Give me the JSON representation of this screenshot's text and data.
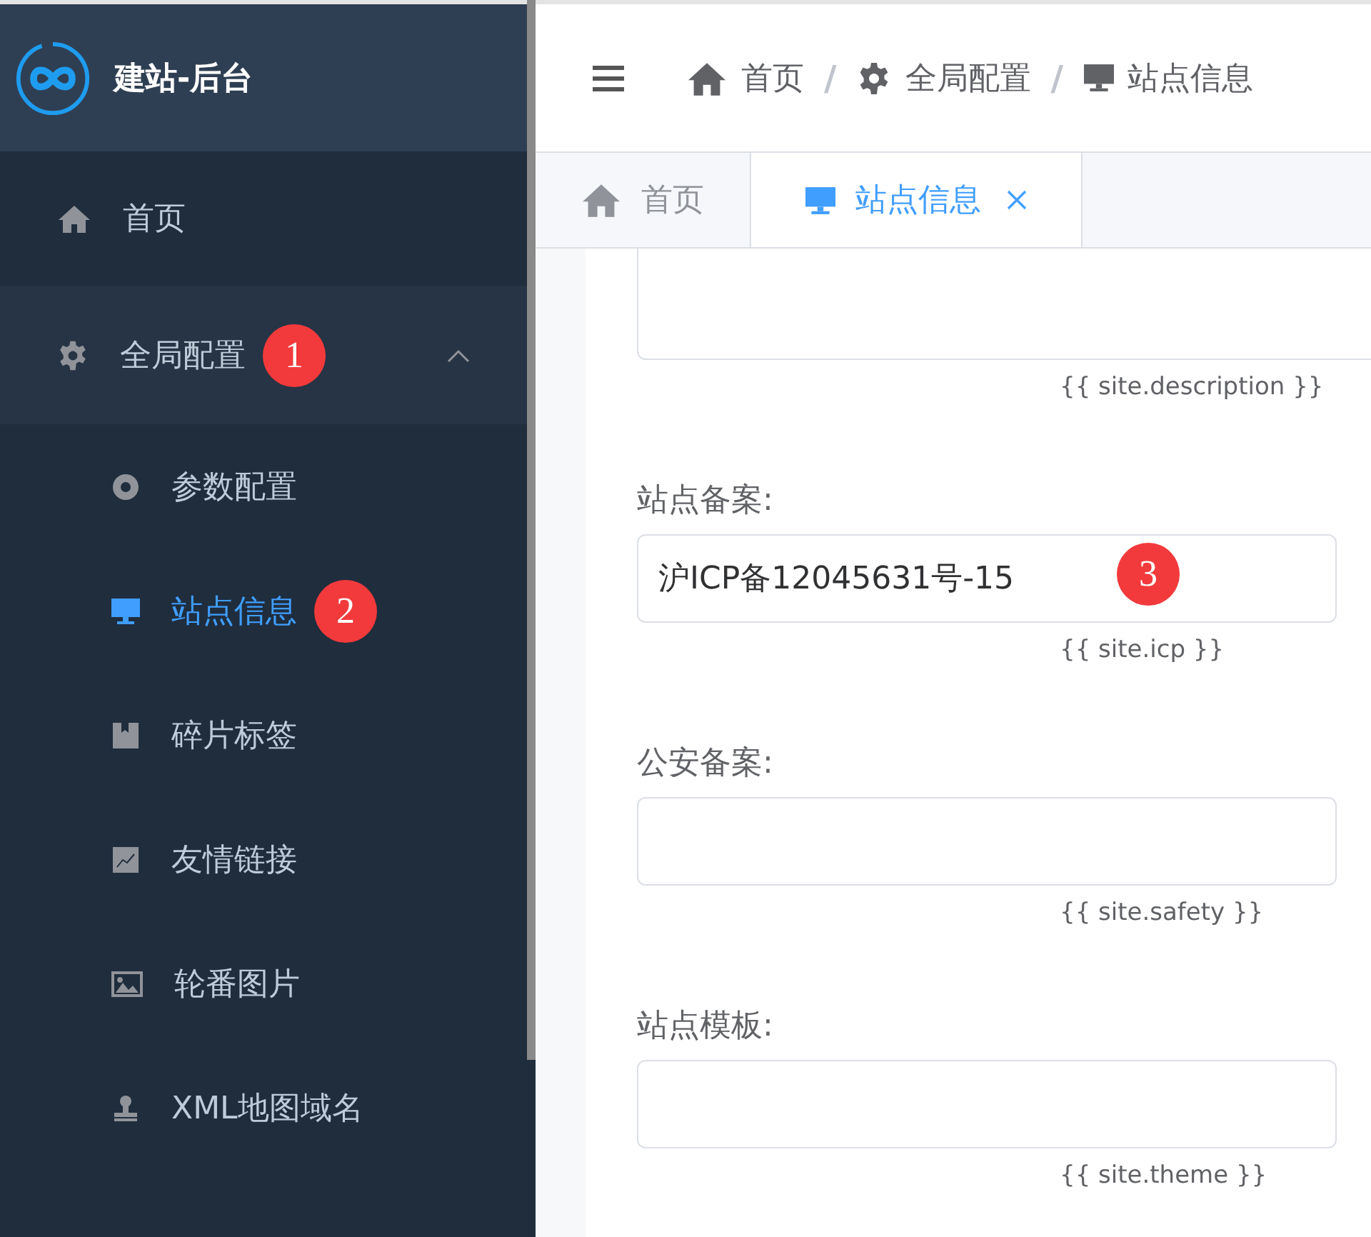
{
  "sidebar": {
    "logo_title": "建站-后台",
    "menu": [
      {
        "label": "首页",
        "selected": false
      },
      {
        "label": "全局配置",
        "selected": false,
        "expanded": true,
        "badge": "1",
        "children": [
          {
            "label": "参数配置",
            "selected": false
          },
          {
            "label": "站点信息",
            "selected": true,
            "badge": "2"
          },
          {
            "label": "碎片标签",
            "selected": false
          },
          {
            "label": "友情链接",
            "selected": false
          },
          {
            "label": "轮番图片",
            "selected": false
          },
          {
            "label": "XML地图域名",
            "selected": false
          }
        ]
      }
    ]
  },
  "breadcrumb": [
    {
      "label": "首页"
    },
    {
      "label": "全局配置"
    },
    {
      "label": "站点信息"
    }
  ],
  "breadcrumb_separator": "/",
  "tabs": [
    {
      "label": "首页",
      "selected": false,
      "closable": false
    },
    {
      "label": "站点信息",
      "selected": true,
      "closable": true
    }
  ],
  "form": {
    "fields": [
      {
        "kind": "textarea",
        "hint": "{{ site.description }}"
      },
      {
        "kind": "input",
        "label": "站点备案:",
        "value": "沪ICP备12045631号-15",
        "hint": "{{ site.icp }}",
        "badge": "3"
      },
      {
        "kind": "input",
        "label": "公安备案:",
        "hint": "{{ site.safety }}"
      },
      {
        "kind": "input",
        "label": "站点模板:",
        "hint": "{{ site.theme }}"
      }
    ]
  }
}
